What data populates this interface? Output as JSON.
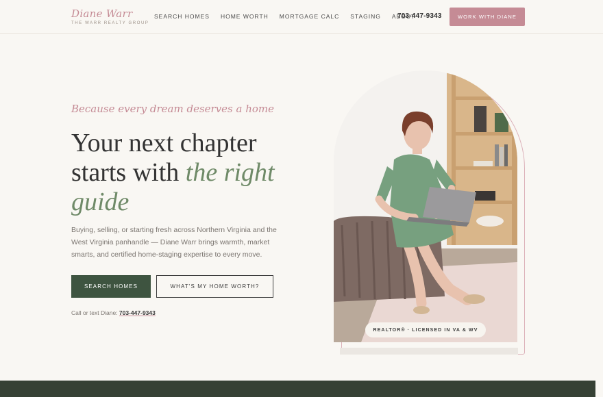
{
  "header": {
    "logo_script": "Diane Warr",
    "logo_sub": "THE WARR REALTY GROUP",
    "nav": [
      "SEARCH HOMES",
      "HOME WORTH",
      "MORTGAGE CALC",
      "STAGING",
      "ABOUT"
    ],
    "phone": "703-447-9343",
    "cta_label": "WORK WITH DIANE"
  },
  "hero": {
    "tagline": "Because every dream deserves a home",
    "headline_line1": "Your next chapter",
    "headline_line2_plain": "starts with ",
    "headline_line2_accent": "the right",
    "headline_line3_accent": "guide",
    "lede": "Buying, selling, or starting fresh across Northern Virginia and the West Virginia panhandle — Diane Warr brings warmth, market smarts, and certified home-staging expertise to every move.",
    "primary_button": "SEARCH HOMES",
    "secondary_button": "WHAT'S MY HOME WORTH?",
    "call_prefix": "Call or text Diane: ",
    "call_phone": "703-447-9343",
    "photo_badge": "REALTOR® · LICENSED IN VA & WV"
  },
  "colors": {
    "accent_pink": "#c58b95",
    "accent_green": "#6f8a68",
    "button_green": "#3e5440",
    "footer_band": "#364135",
    "background": "#f9f7f3"
  }
}
